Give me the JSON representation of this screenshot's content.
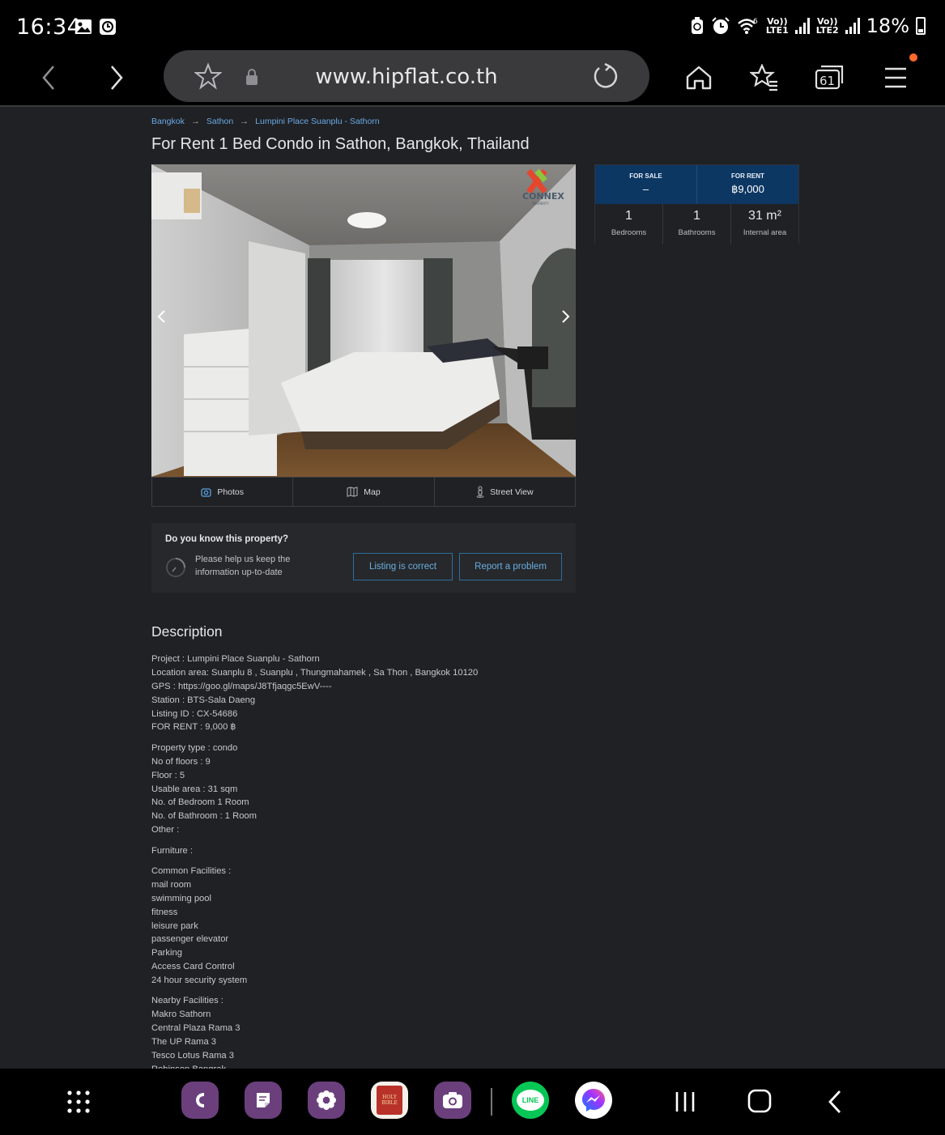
{
  "status_bar": {
    "time": "16:34",
    "network_1": "LTE1",
    "network_2": "LTE2",
    "volte": "Vo))",
    "wifi_label": "6",
    "battery": "18%"
  },
  "browser": {
    "url": "www.hipflat.co.th",
    "tabs_count": "61"
  },
  "breadcrumb": [
    "Bangkok",
    "Sathon",
    "Lumpini Place Suanplu - Sathorn"
  ],
  "listing": {
    "title": "For Rent 1 Bed Condo in Sathon, Bangkok, Thailand",
    "watermark": "CONNEX",
    "watermark_sub": "PROPERTY"
  },
  "gallery_tabs": [
    "Photos",
    "Map",
    "Street View"
  ],
  "price": {
    "sale_label": "FOR SALE",
    "sale_value": "–",
    "rent_label": "FOR RENT",
    "rent_value": "฿9,000"
  },
  "stats": [
    {
      "value": "1",
      "label": "Bedrooms"
    },
    {
      "value": "1",
      "label": "Bathrooms"
    },
    {
      "value": "31 m²",
      "label": "Internal area"
    }
  ],
  "feedback": {
    "question": "Do you know this property?",
    "help_line1": "Please help us keep the",
    "help_line2": "information up-to-date",
    "correct_button": "Listing is correct",
    "report_button": "Report a problem"
  },
  "description": {
    "title": "Description",
    "lines": [
      "Project : Lumpini Place Suanplu - Sathorn",
      "Location area: Suanplu 8 , Suanplu , Thungmahamek , Sa Thon , Bangkok 10120",
      "GPS : https://goo.gl/maps/J8Tfjaqgc5EwV----",
      "Station : BTS-Sala Daeng",
      "Listing ID : CX-54686",
      "FOR RENT : 9,000 ฿",
      "",
      "Property type : condo",
      "No of floors : 9",
      "Floor : 5",
      "Usable area : 31 sqm",
      "No. of Bedroom 1 Room",
      "No. of Bathroom : 1 Room",
      "Other :",
      "",
      "Furniture :",
      "",
      "Common Facilities :",
      "mail room",
      "swimming pool",
      "fitness",
      "leisure park",
      "passenger elevator",
      "Parking",
      "Access Card Control",
      "24 hour security system",
      "",
      "Nearby Facilities :",
      "Makro Sathorn",
      "Central Plaza Rama 3",
      "The UP Rama 3",
      "Tesco Lotus Rama 3",
      "Robinson Bangrak"
    ]
  },
  "dock": {
    "bible_label_1": "HOLY",
    "bible_label_2": "BIBLE",
    "line_label": "LINE"
  },
  "colors": {
    "accent_link": "#69a8e6",
    "price_header": "#0d3763",
    "notification": "#ff6a2b",
    "line_green": "#06c755"
  }
}
